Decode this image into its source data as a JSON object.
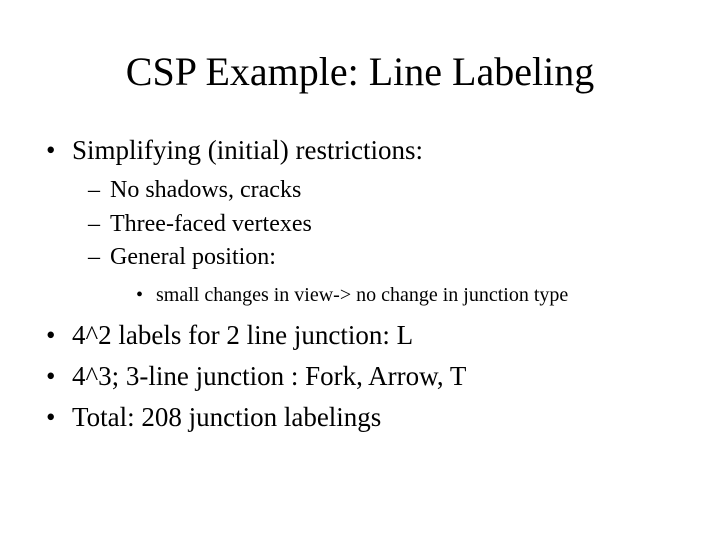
{
  "title": "CSP Example: Line Labeling",
  "bullets": {
    "b0": "Simplifying (initial) restrictions:",
    "b0_sub": {
      "s0": "No shadows, cracks",
      "s1": "Three-faced vertexes",
      "s2": "General position:",
      "s2_sub": {
        "t0": "small changes in view-> no change in junction type"
      }
    },
    "b1": "4^2 labels for 2 line junction: L",
    "b2": "4^3; 3-line junction : Fork, Arrow, T",
    "b3": "Total: 208 junction labelings"
  }
}
